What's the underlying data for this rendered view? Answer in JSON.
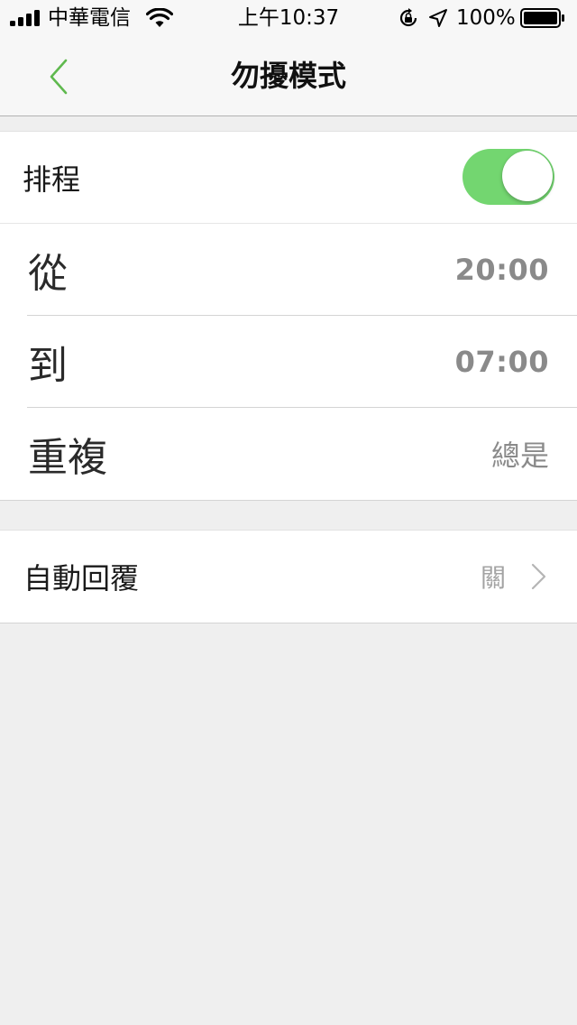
{
  "status_bar": {
    "carrier": "中華電信",
    "time": "上午10:37",
    "battery_percent": "100%",
    "battery_level": 1.0,
    "icons": [
      "signal-icon",
      "wifi-icon",
      "orientation-lock-icon",
      "location-icon",
      "battery-icon"
    ]
  },
  "nav": {
    "title": "勿擾模式",
    "back_icon": "chevron-left-icon"
  },
  "colors": {
    "accent_green": "#5fb94e",
    "toggle_on": "#73d670",
    "background": "#efefef",
    "value_gray": "#8a8a8a"
  },
  "schedule": {
    "label": "排程",
    "enabled": true,
    "from_label": "從",
    "from_value": "20:00",
    "to_label": "到",
    "to_value": "07:00",
    "repeat_label": "重複",
    "repeat_value": "總是"
  },
  "auto_reply": {
    "label": "自動回覆",
    "value": "關",
    "icon": "chevron-right-icon"
  }
}
